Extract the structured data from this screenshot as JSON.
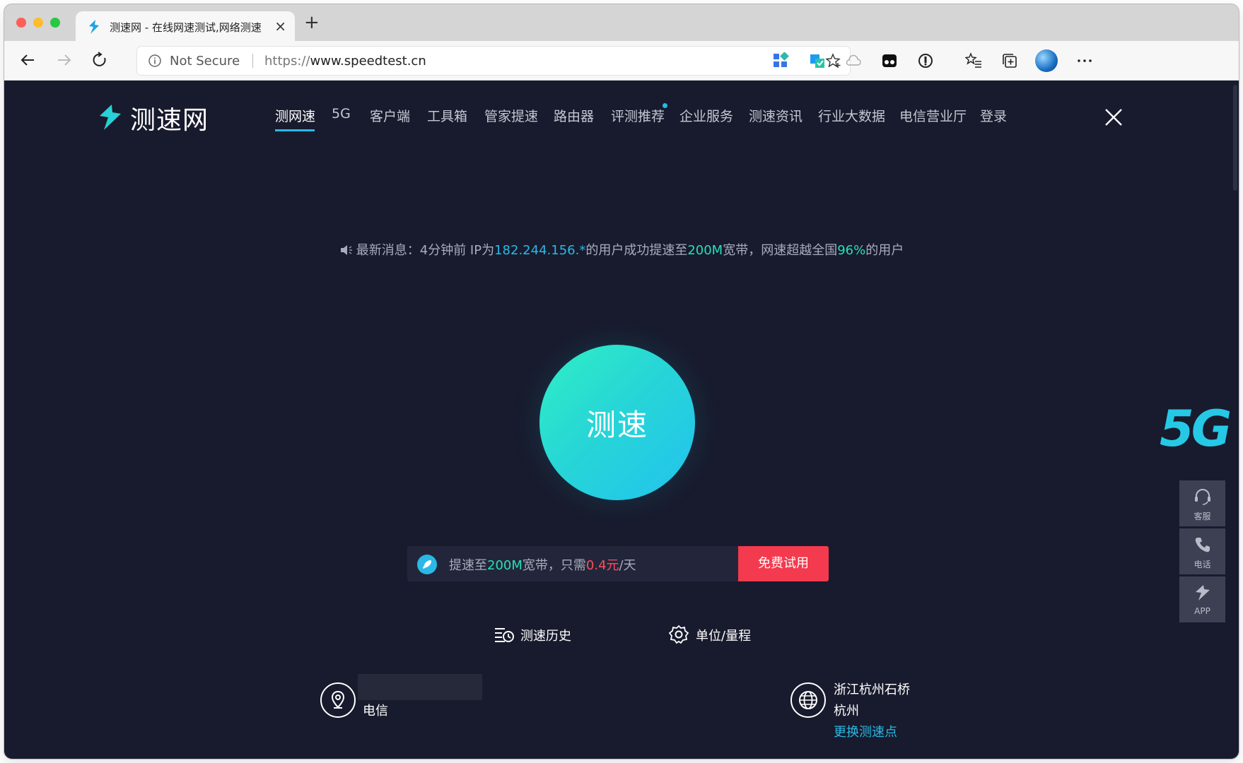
{
  "browser": {
    "tab_title": "测速网 - 在线网速测试,网络测速",
    "tab_close": "×",
    "new_tab": "+",
    "address": {
      "security_text": "Not Secure",
      "url_prefix": "https://",
      "url_domain": "www.speedtest.cn"
    }
  },
  "site": {
    "logo_text": "测速网",
    "nav": [
      {
        "label": "测网速",
        "active": true
      },
      {
        "label": "5G"
      },
      {
        "label": "客户端"
      },
      {
        "label": "工具箱"
      },
      {
        "label": "管家提速"
      },
      {
        "label": "路由器"
      },
      {
        "label": "评测推荐",
        "badge_dot": true
      },
      {
        "label": "企业服务"
      },
      {
        "label": "测速资讯"
      },
      {
        "label": "行业大数据"
      },
      {
        "label": "电信营业厅"
      },
      {
        "label": "登录"
      }
    ],
    "colors": {
      "background": "#181b2d",
      "accent_blue": "#2ab8e6",
      "accent_green": "#25e0ba",
      "cta_red": "#f33a4e"
    }
  },
  "notice": {
    "prefix": "最新消息：4分钟前 IP为",
    "ip": "182.244.156.*",
    "middle": "的用户成功提速至",
    "speed": "200M",
    "middle2": "宽带，网速超越全国",
    "percent": "96%",
    "suffix": "的用户"
  },
  "speed_button": {
    "label": "测速"
  },
  "promo": {
    "text_prefix": "提速至",
    "bandwidth": "200M",
    "text_mid": "宽带，只需",
    "price": "0.4元",
    "text_suffix": "/天",
    "cta_label": "免费试用"
  },
  "actions": {
    "history_label": "测速历史",
    "units_label": "单位/量程"
  },
  "isp": {
    "name": "电信"
  },
  "server": {
    "location": "浙江杭州石桥",
    "city": "杭州",
    "change_label": "更换测速点"
  },
  "side": {
    "badge_5g": "5G",
    "tools": [
      {
        "label": "客服",
        "icon": "headset-icon"
      },
      {
        "label": "电话",
        "icon": "phone-icon"
      },
      {
        "label": "APP",
        "icon": "app-logo-icon"
      }
    ]
  }
}
